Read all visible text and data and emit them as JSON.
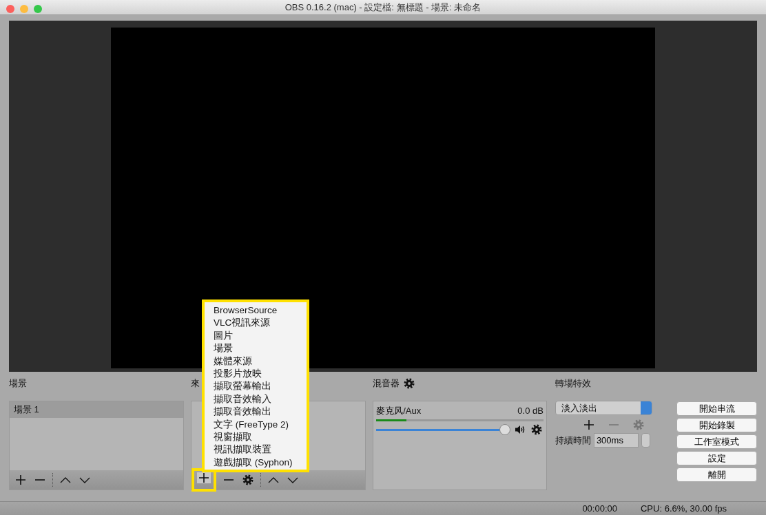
{
  "window": {
    "title": "OBS 0.16.2 (mac) - 設定檔: 無標題 - 場景: 未命名"
  },
  "scenes": {
    "title": "場景",
    "items": [
      {
        "label": "場景 1",
        "selected": true
      }
    ]
  },
  "sources": {
    "title": "來"
  },
  "add_menu": {
    "items": [
      "BrowserSource",
      "VLC視訊來源",
      "圖片",
      "場景",
      "媒體來源",
      "投影片放映",
      "擷取螢幕輸出",
      "擷取音效輸入",
      "擷取音效輸出",
      "文字 (FreeType 2)",
      "視窗擷取",
      "視訊擷取裝置",
      "遊戲擷取 (Syphon)"
    ]
  },
  "mixer": {
    "title": "混音器",
    "channels": [
      {
        "name": "麥克风/Aux",
        "reading": "0.0 dB",
        "meter": {
          "level": 0.18
        },
        "volume": {
          "level": 1.0
        }
      }
    ]
  },
  "transitions": {
    "title": "轉場特效",
    "selected": "淡入淡出",
    "duration_label": "持續時間",
    "duration": "300ms"
  },
  "controls": [
    "開始串流",
    "開始錄製",
    "工作室模式",
    "設定",
    "離開"
  ],
  "status_bar": {
    "time": "00:00:00",
    "stats": "CPU: 6.6%, 30.00 fps"
  }
}
